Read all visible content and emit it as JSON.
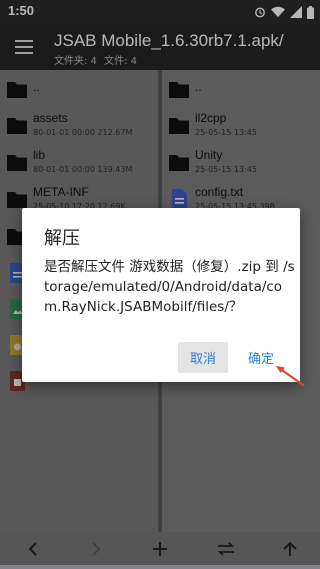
{
  "status_bar": {
    "time": "1:50",
    "icons": [
      "alarm-icon",
      "wifi-icon",
      "signal-icon",
      "battery-icon"
    ]
  },
  "app_bar": {
    "title": "JSAB Mobile_1.6.30rb7.1.apk/",
    "folders_label": "文件夹: 4",
    "files_label": "文件: 4"
  },
  "left_pane": {
    "items": [
      {
        "name": "..",
        "meta": "",
        "icon": "folder-icon"
      },
      {
        "name": "assets",
        "meta": "80-01-01 00:00  212.67M",
        "icon": "folder-icon"
      },
      {
        "name": "lib",
        "meta": "80-01-01 00:00  139.43M",
        "icon": "folder-icon"
      },
      {
        "name": "META-INF",
        "meta": "25-05-10 17:20  12.69K",
        "icon": "folder-icon"
      }
    ]
  },
  "right_pane": {
    "items": [
      {
        "name": "..",
        "meta": "",
        "icon": "folder-icon"
      },
      {
        "name": "il2cpp",
        "meta": "25-05-15 13:45",
        "icon": "folder-icon"
      },
      {
        "name": "Unity",
        "meta": "25-05-15 13:45",
        "icon": "folder-icon"
      },
      {
        "name": "config.txt",
        "meta": "25-05-15 13:45  39B",
        "icon": "text-file-icon"
      }
    ]
  },
  "dialog": {
    "title": "解压",
    "message": "是否解压文件 游戏数据（修复）.zip 到 /storage/emulated/0/Android/data/com.RayNick.JSABMobilf/files/？",
    "cancel_label": "取消",
    "ok_label": "确定"
  },
  "toolbar": {
    "icons": [
      "back-icon",
      "forward-icon",
      "add-icon",
      "swap-icon",
      "up-icon"
    ]
  },
  "colors": {
    "accent": "#2f7fd0",
    "annotation_arrow": "#e0463a",
    "pane_bg": "#7a7a7a",
    "appbar_bg": "#262626"
  }
}
